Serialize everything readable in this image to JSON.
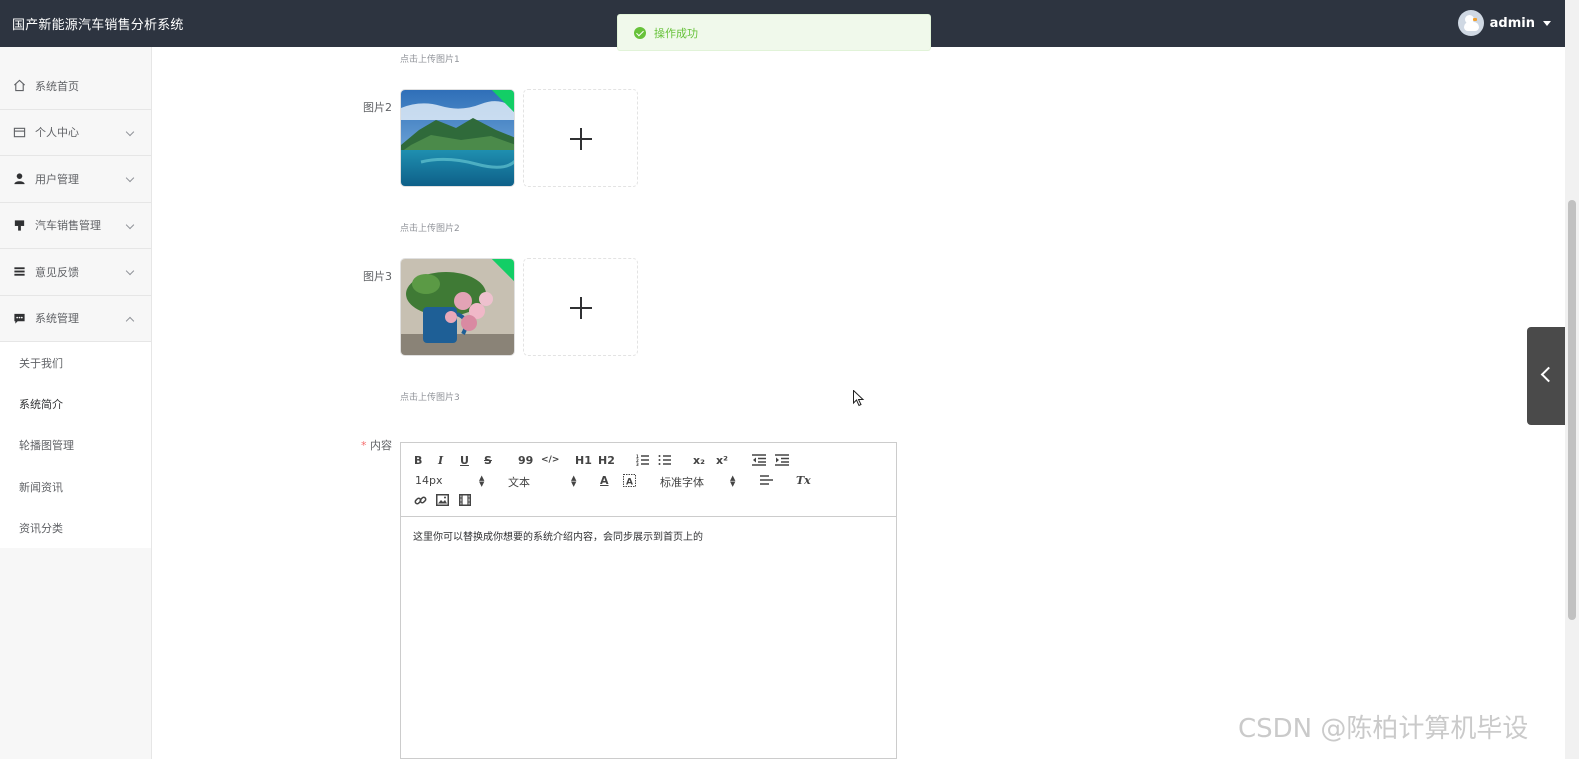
{
  "header": {
    "app_title": "国产新能源汽车销售分析系统",
    "username": "admin"
  },
  "toast": {
    "message": "操作成功"
  },
  "sidebar": {
    "items": [
      {
        "label": "系统首页",
        "icon": "home-icon"
      },
      {
        "label": "个人中心",
        "icon": "card-icon"
      },
      {
        "label": "用户管理",
        "icon": "user-icon"
      },
      {
        "label": "汽车销售管理",
        "icon": "brush-icon"
      },
      {
        "label": "意见反馈",
        "icon": "list-icon"
      },
      {
        "label": "系统管理",
        "icon": "chat-icon"
      }
    ],
    "submenu": [
      {
        "label": "关于我们"
      },
      {
        "label": "系统简介"
      },
      {
        "label": "轮播图管理"
      },
      {
        "label": "新闻资讯"
      },
      {
        "label": "资讯分类"
      }
    ]
  },
  "form": {
    "hint1": "点击上传图片1",
    "label_pic2": "图片2",
    "hint2": "点击上传图片2",
    "label_pic3": "图片3",
    "hint3": "点击上传图片3",
    "label_content_required": "*",
    "label_content": "内容"
  },
  "editor": {
    "toolbar": {
      "bold": "B",
      "italic": "I",
      "underline": "U",
      "strike": "S",
      "quote": "99",
      "code": "</>",
      "h1": "H1",
      "h2": "H2",
      "sub": "x₂",
      "sup": "x²",
      "size": "14px",
      "header_select": "文本",
      "font_select": "标准字体",
      "clear": "Tx"
    },
    "content": "这里你可以替换成你想要的系统介绍内容，会同步展示到首页上的"
  },
  "watermark": "CSDN @陈柏计算机毕设"
}
